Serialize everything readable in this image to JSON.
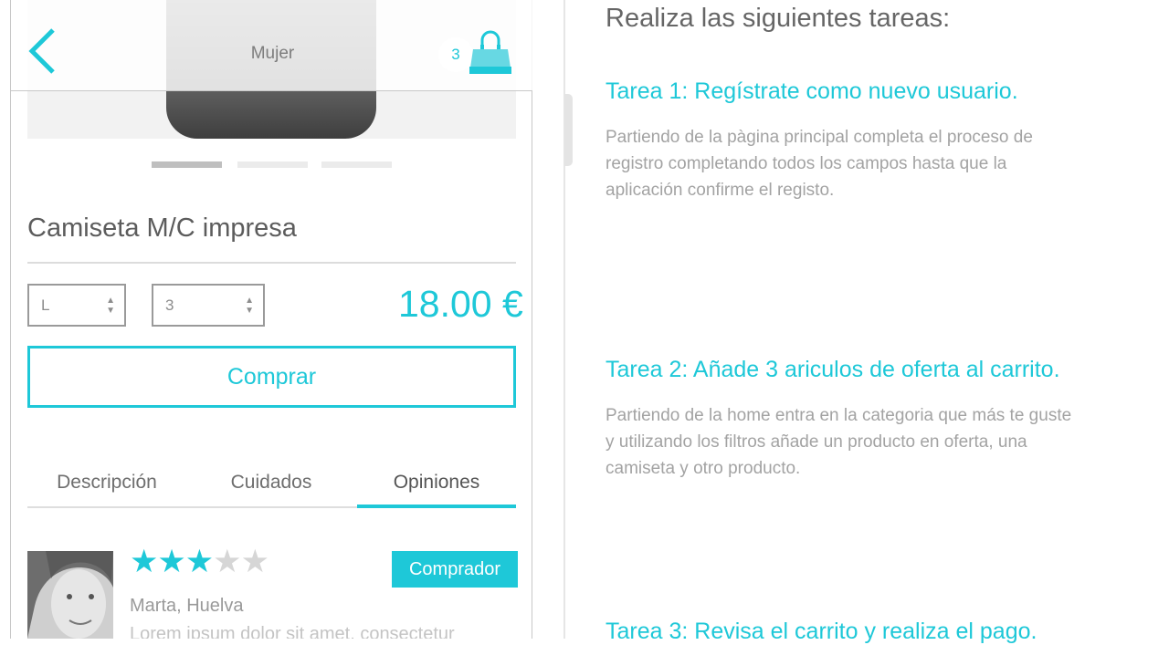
{
  "phone": {
    "nav": {
      "title": "Mujer",
      "cart_count": "3"
    },
    "carousel": {
      "slides": 3,
      "active": 0
    },
    "product": {
      "name": "Camiseta M/C impresa",
      "size": "L",
      "quantity": "3",
      "price": "18.00 €",
      "buy_label": "Comprar"
    },
    "tabs": [
      {
        "label": "Descripción"
      },
      {
        "label": "Cuidados"
      },
      {
        "label": "Opiniones"
      }
    ],
    "active_tab": "Opiniones",
    "review": {
      "rating": 3,
      "max_rating": 5,
      "star_glyph": "★",
      "badge": "Comprador",
      "author": "Marta, Huelva",
      "text": "Lorem ipsum dolor sit amet, consectetur"
    }
  },
  "instructions": {
    "heading": "Realiza las siguientes tareas:",
    "tasks": [
      {
        "title": "Tarea 1: Regístrate como nuevo usuario.",
        "description": "Partiendo de la pàgina principal completa el proceso de registro completando todos los campos  hasta que la aplicación confirme el registo."
      },
      {
        "title": "Tarea 2: Añade 3 ariculos de oferta al carrito.",
        "description": "Partiendo de la home entra en la categoria que más te guste y utilizando los filtros añade un producto en oferta, una camiseta y otro producto."
      },
      {
        "title": "Tarea 3: Revisa el carrito y realiza el pago."
      }
    ]
  },
  "colors": {
    "accent": "#1ec8d8",
    "text_dark": "#5c5c5c",
    "text_muted": "#a3a3a3"
  },
  "icons": {
    "back": "chevron-left-icon",
    "cart": "shopping-bag-icon",
    "star": "star-icon",
    "select_arrows": "up-down-arrows-icon"
  }
}
